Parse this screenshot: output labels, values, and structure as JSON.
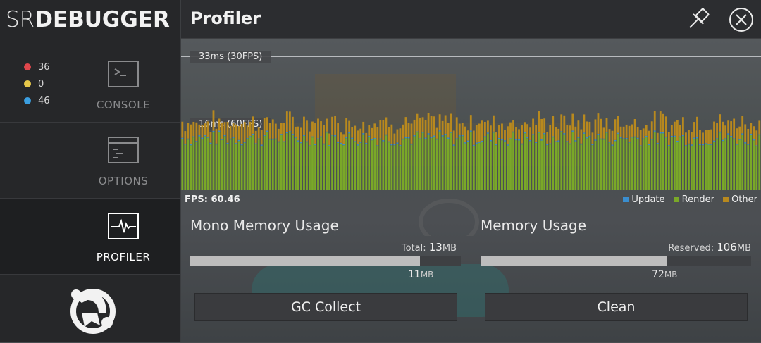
{
  "app": {
    "logo_light": "SR",
    "logo_bold": "DEBUGGER"
  },
  "header": {
    "title": "Profiler"
  },
  "sidebar": {
    "counters": [
      {
        "value": "36",
        "color": "#e0474c"
      },
      {
        "value": "0",
        "color": "#e6c84a"
      },
      {
        "value": "46",
        "color": "#3b9fe0"
      }
    ],
    "items": [
      {
        "label": "CONSOLE",
        "icon": "console-icon"
      },
      {
        "label": "OPTIONS",
        "icon": "options-icon"
      },
      {
        "label": "PROFILER",
        "icon": "profiler-icon",
        "active": true
      }
    ]
  },
  "profiler": {
    "guide_33": "33ms (30FPS)",
    "guide_16": "16ms (60FPS)",
    "fps": "FPS: 60.46",
    "legend": [
      {
        "label": "Update",
        "color": "#3a8ecf"
      },
      {
        "label": "Render",
        "color": "#7aa828"
      },
      {
        "label": "Other",
        "color": "#b8891e"
      }
    ]
  },
  "mono_memory": {
    "title": "Mono Memory Usage",
    "total_label": "Total:",
    "total_value": "13",
    "total_unit": "MB",
    "used_value": "11",
    "used_unit": "MB",
    "fill_percent": 85
  },
  "memory": {
    "title": "Memory Usage",
    "total_label": "Reserved:",
    "total_value": "106",
    "total_unit": "MB",
    "used_value": "72",
    "used_unit": "MB",
    "fill_percent": 69
  },
  "buttons": {
    "gc_collect": "GC Collect",
    "clean": "Clean"
  }
}
